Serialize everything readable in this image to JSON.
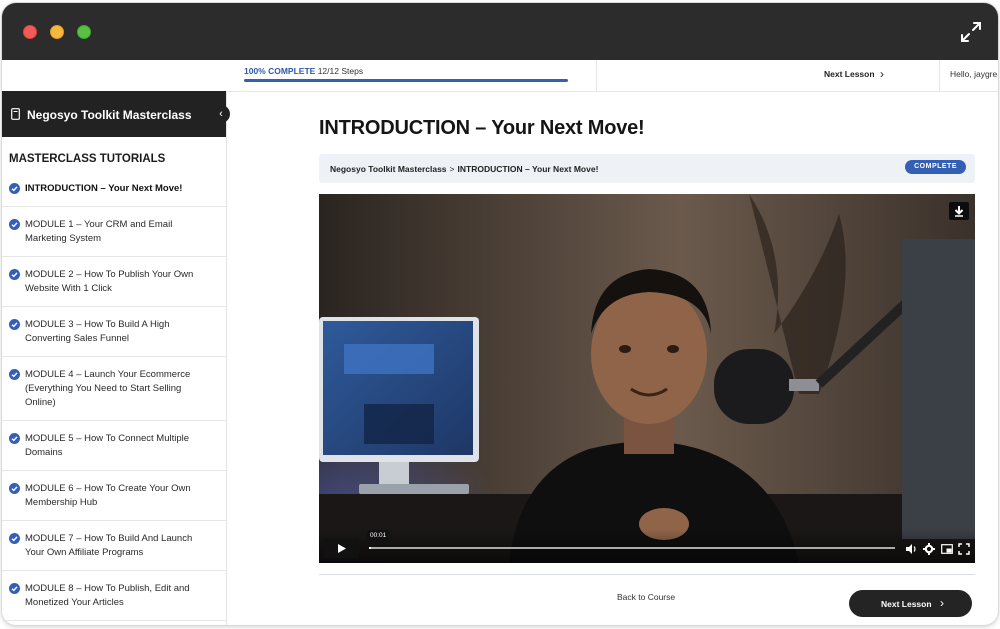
{
  "window": {
    "controls": [
      "close",
      "minimize",
      "zoom"
    ],
    "fullscreen_icon": "expand-arrows-icon"
  },
  "topbar": {
    "progress_label": "100% COMPLETE",
    "steps": "12/12 Steps",
    "progress_percent": 100,
    "next_lesson": "Next Lesson",
    "greeting": "Hello, jaygre"
  },
  "sidebar": {
    "course_title": "Negosyo Toolkit Masterclass",
    "section_title": "MASTERCLASS TUTORIALS",
    "lessons": [
      {
        "label": "INTRODUCTION – Your Next Move!",
        "completed": true,
        "active": true
      },
      {
        "label": "MODULE 1 – Your CRM and Email Marketing System",
        "completed": true
      },
      {
        "label": "MODULE 2 – How To Publish Your Own Website With 1 Click",
        "completed": true
      },
      {
        "label": "MODULE 3 – How To Build A High Converting Sales Funnel",
        "completed": true
      },
      {
        "label": "MODULE 4 – Launch Your Ecommerce (Everything You Need to Start Selling Online)",
        "completed": true
      },
      {
        "label": "MODULE 5 – How To Connect Multiple Domains",
        "completed": true
      },
      {
        "label": "MODULE 6 – How To Create Your Own Membership Hub",
        "completed": true
      },
      {
        "label": "MODULE 7 – How To Build And Launch Your Own Affiliate Programs",
        "completed": true
      },
      {
        "label": "MODULE 8 – How To Publish, Edit and Monetized Your Articles",
        "completed": true
      }
    ]
  },
  "main": {
    "title": "INTRODUCTION – Your Next Move!",
    "breadcrumb": {
      "course": "Negosyo Toolkit Masterclass",
      "separator": ">",
      "current": "INTRODUCTION – Your Next Move!"
    },
    "status_badge": "COMPLETE",
    "video": {
      "current_time": "00:01"
    },
    "back_to_course": "Back to Course",
    "next_lesson_button": "Next Lesson"
  },
  "colors": {
    "accent": "#3360b5",
    "titlebar": "#2c2c2c",
    "sidebar_header": "#222222",
    "button_dark": "#242424"
  }
}
